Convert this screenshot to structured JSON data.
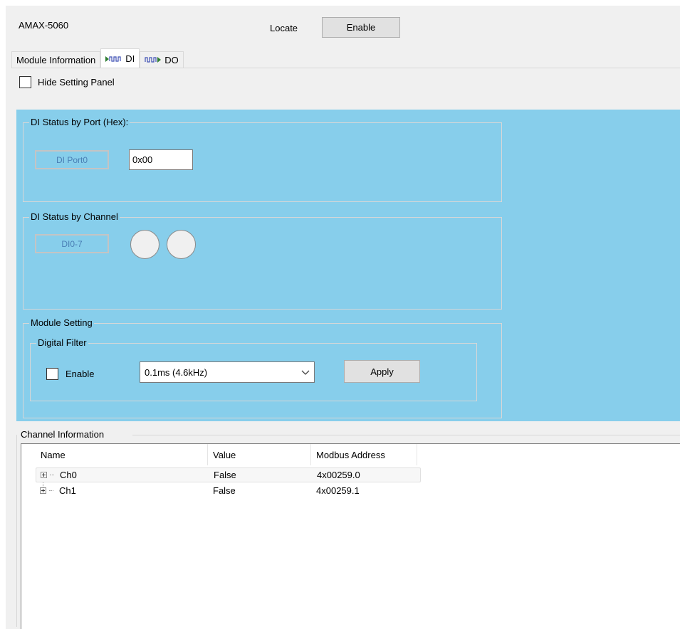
{
  "header": {
    "device_name": "AMAX-5060",
    "locate_label": "Locate",
    "locate_button": "Enable"
  },
  "tabs": [
    {
      "label": "Module Information",
      "icon": "none",
      "active": false
    },
    {
      "label": "DI",
      "icon": "di-signal-icon",
      "active": true
    },
    {
      "label": "DO",
      "icon": "do-signal-icon",
      "active": false
    }
  ],
  "settings": {
    "hide_panel_label": "Hide Setting Panel",
    "hide_panel_checked": false
  },
  "di_port": {
    "group_title": "DI Status by Port (Hex):",
    "port_label": "DI Port0",
    "port_value": "0x00"
  },
  "di_channel": {
    "group_title": "DI Status by Channel",
    "range_label": "DI0-7",
    "led_count": 2
  },
  "module_setting": {
    "group_title": "Module Setting",
    "filter_title": "Digital Filter",
    "enable_label": "Enable",
    "enable_checked": false,
    "filter_value": "0.1ms (4.6kHz)",
    "apply_label": "Apply"
  },
  "channel_info": {
    "group_title": "Channel Information",
    "columns": [
      "Name",
      "Value",
      "Modbus Address"
    ],
    "rows": [
      {
        "name": "Ch0",
        "value": "False",
        "address": "4x00259.0"
      },
      {
        "name": "Ch1",
        "value": "False",
        "address": "4x00259.1"
      }
    ]
  },
  "colors": {
    "panel_blue": "#87ceeb",
    "window_bg": "#f0f0f0",
    "label_text_blue": "#4a7fb5"
  }
}
